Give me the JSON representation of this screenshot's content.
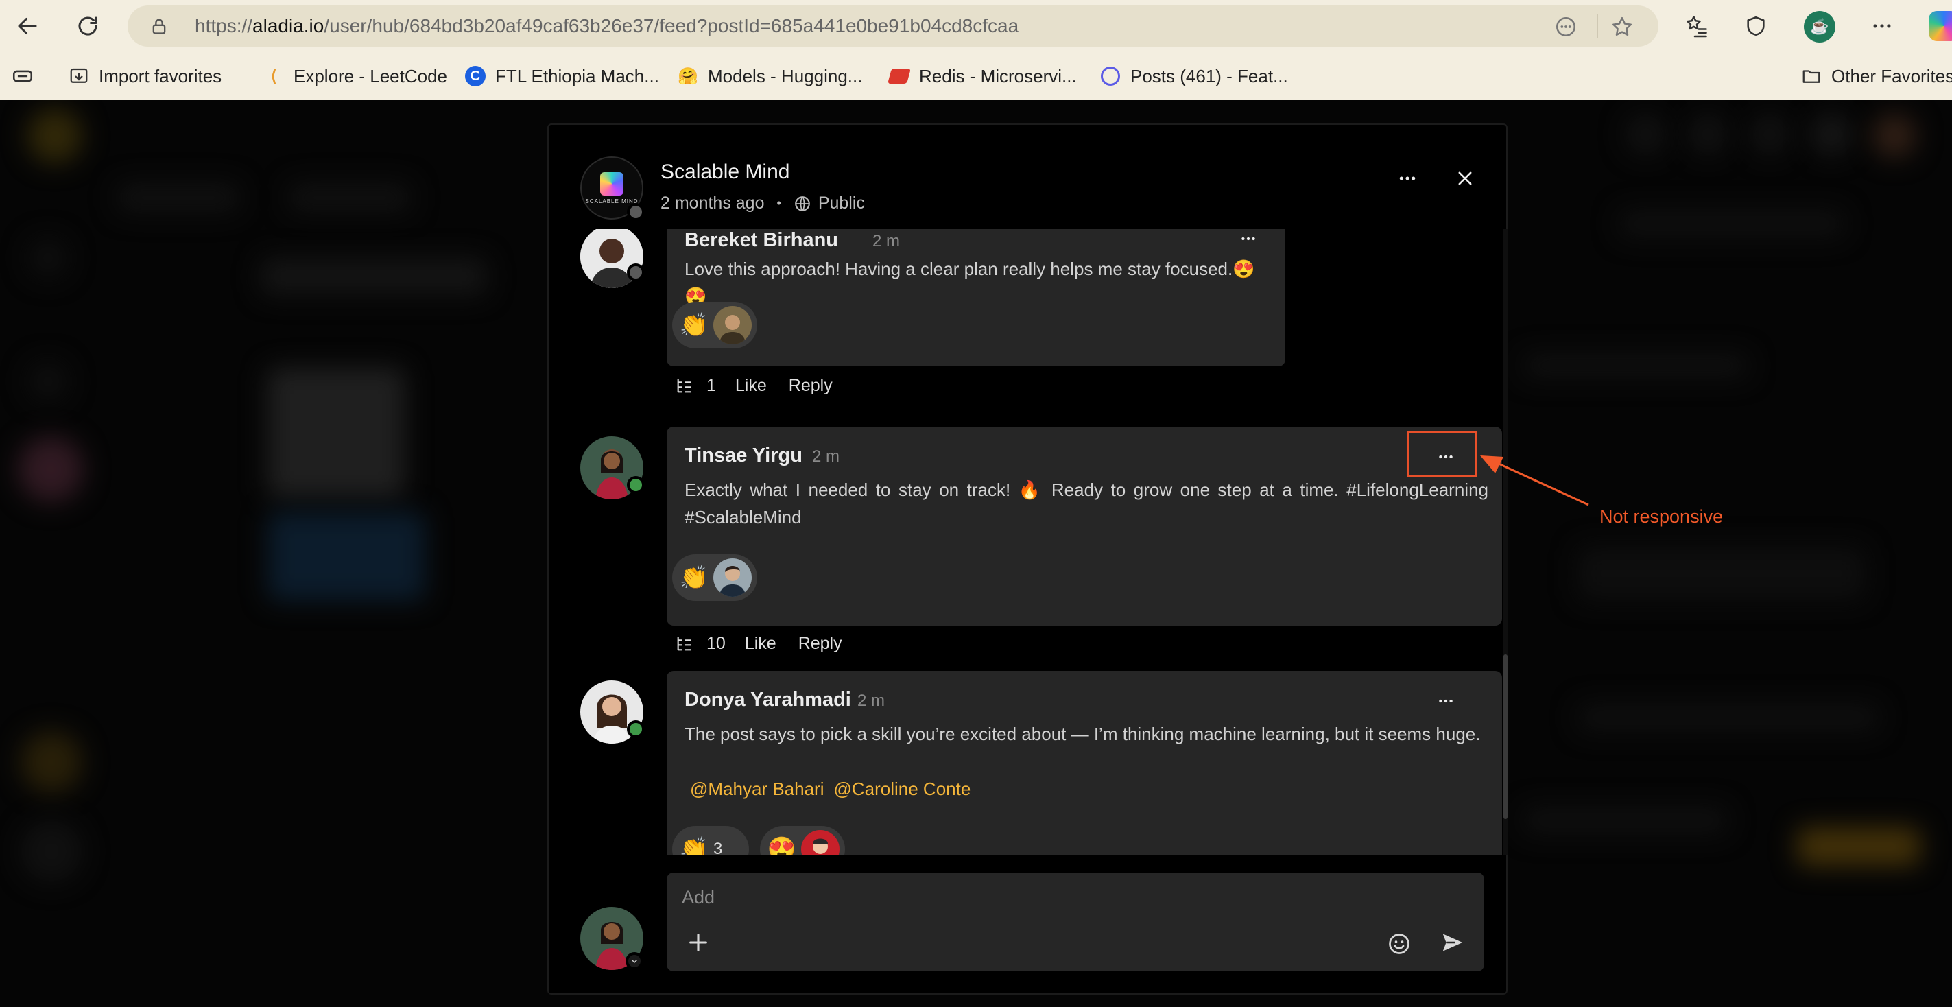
{
  "browser": {
    "url_prefix": "https://",
    "url_domain": "aladia.io",
    "url_path": "/user/hub/684bd3b20af49caf63b26e37/feed?postId=685a441e0be91b04cd8cfcaa",
    "bookmarks": [
      {
        "label": "Import favorites",
        "icon": "import-icon"
      },
      {
        "label": "Explore - LeetCode",
        "icon": "leetcode-icon"
      },
      {
        "label": "FTL Ethiopia Mach...",
        "icon": "c-logo-icon"
      },
      {
        "label": "Models - Hugging...",
        "icon": "hugging-face-icon"
      },
      {
        "label": "Redis - Microservi...",
        "icon": "redis-icon"
      },
      {
        "label": "Posts (461) - Feat...",
        "icon": "posts-icon"
      }
    ],
    "other_favorites": "Other Favorites"
  },
  "post": {
    "author": "Scalable Mind",
    "logo_text": "SCALABLE MIND",
    "time": "2 months ago",
    "dot": "•",
    "visibility": "Public"
  },
  "comments": [
    {
      "name": "Bereket Birhanu",
      "time": "2 m",
      "text": "Love this approach! Having a clear plan really helps me stay focused.😍😍",
      "reaction_emoji": "👏",
      "replies": "1",
      "like": "Like",
      "reply": "Reply"
    },
    {
      "name": "Tinsae Yirgu",
      "time": "2 m",
      "text": "Exactly what I needed to stay on track! 🔥 Ready to grow one step at a time. #LifelongLearning #ScalableMind",
      "reaction_emoji": "👏",
      "replies": "10",
      "like": "Like",
      "reply": "Reply"
    },
    {
      "name": "Donya Yarahmadi",
      "time": "2 m",
      "text": "The post says to pick a skill you’re excited about — I’m thinking machine learning, but it seems huge.",
      "mentions": [
        "@Mahyar Bahari",
        "@Caroline Conte"
      ],
      "reaction_emoji": "👏",
      "reaction_count": "3",
      "reaction_emoji_2": "😍"
    }
  ],
  "composer": {
    "placeholder": "Add"
  },
  "annotation": {
    "label": "Not responsive",
    "color": "#f25a2a"
  },
  "colors": {
    "accent_mention": "#f5b63a",
    "online": "#3f9a49",
    "offline": "#5a5a5a",
    "bubble": "#262626"
  }
}
